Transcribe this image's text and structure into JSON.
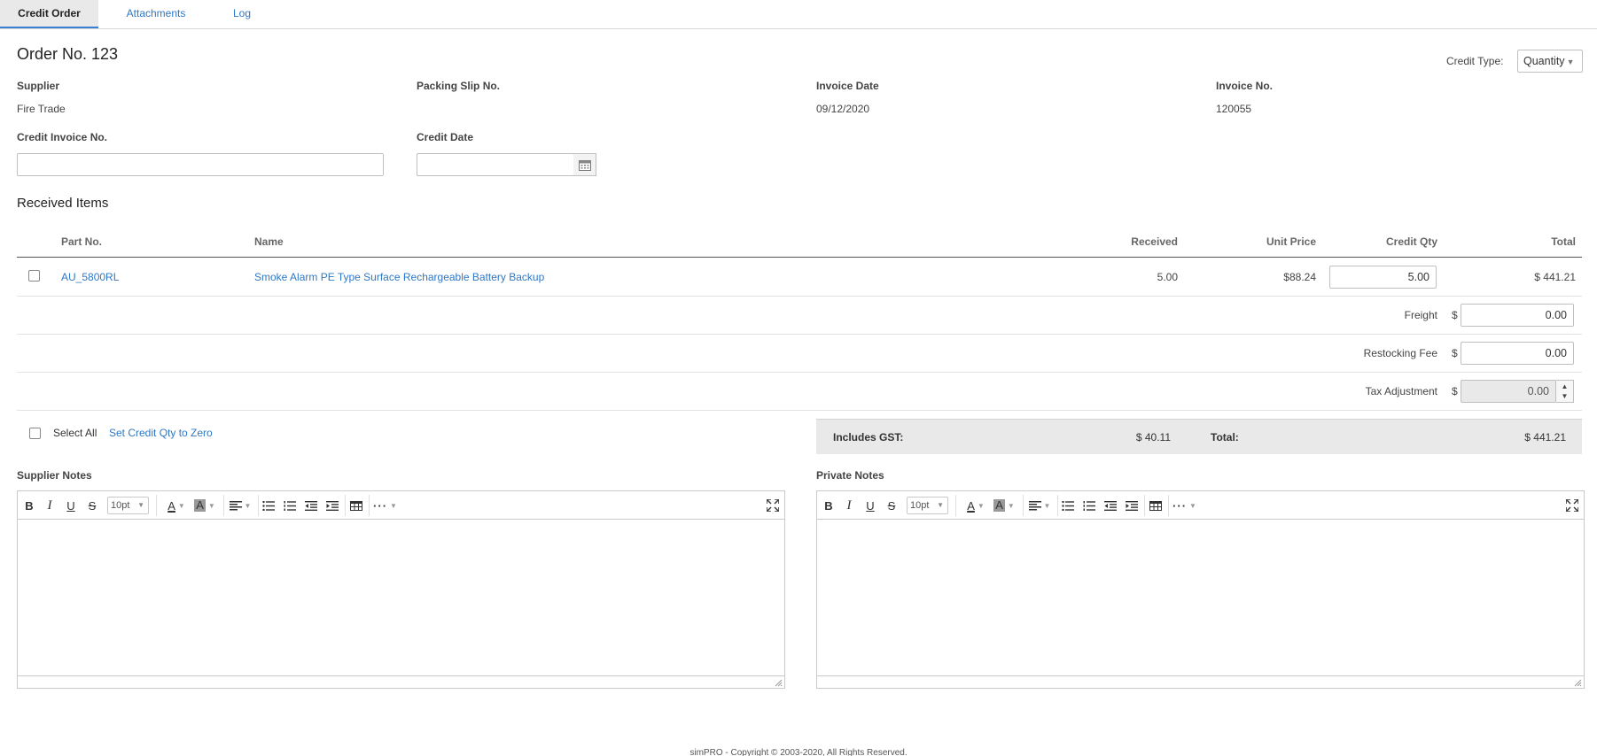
{
  "tabs": [
    {
      "label": "Credit Order",
      "active": true
    },
    {
      "label": "Attachments",
      "active": false
    },
    {
      "label": "Log",
      "active": false
    }
  ],
  "order": {
    "title": "Order No. 123",
    "credit_type_label": "Credit Type:",
    "credit_type_value": "Quantity"
  },
  "fields": {
    "supplier_label": "Supplier",
    "supplier_value": "Fire Trade",
    "packing_slip_label": "Packing Slip No.",
    "packing_slip_value": "",
    "invoice_date_label": "Invoice Date",
    "invoice_date_value": "09/12/2020",
    "invoice_no_label": "Invoice No.",
    "invoice_no_value": "120055",
    "credit_invoice_label": "Credit Invoice No.",
    "credit_invoice_value": "",
    "credit_date_label": "Credit Date",
    "credit_date_value": ""
  },
  "received_items": {
    "section_title": "Received Items",
    "columns": [
      "Part No.",
      "Name",
      "Received",
      "Unit Price",
      "Credit Qty",
      "Total"
    ],
    "rows": [
      {
        "part_no": "AU_5800RL",
        "name": "Smoke Alarm PE Type Surface Rechargeable Battery Backup",
        "received": "5.00",
        "unit_price": "$88.24",
        "credit_qty": "5.00",
        "total": "$ 441.21"
      }
    ],
    "freight_label": "Freight",
    "freight_value": "0.00",
    "restocking_label": "Restocking Fee",
    "restocking_value": "0.00",
    "tax_adj_label": "Tax Adjustment",
    "tax_adj_value": "0.00",
    "currency_symbol": "$"
  },
  "actions": {
    "select_all_label": "Select All",
    "set_zero_label": "Set Credit Qty to Zero"
  },
  "totals": {
    "gst_label": "Includes GST:",
    "gst_value": "$ 40.11",
    "total_label": "Total:",
    "total_value": "$ 441.21"
  },
  "notes": {
    "supplier_label": "Supplier Notes",
    "private_label": "Private Notes",
    "font_size": "10pt"
  },
  "footer": {
    "text": "simPRO - Copyright © 2003-2020, All Rights Reserved."
  }
}
